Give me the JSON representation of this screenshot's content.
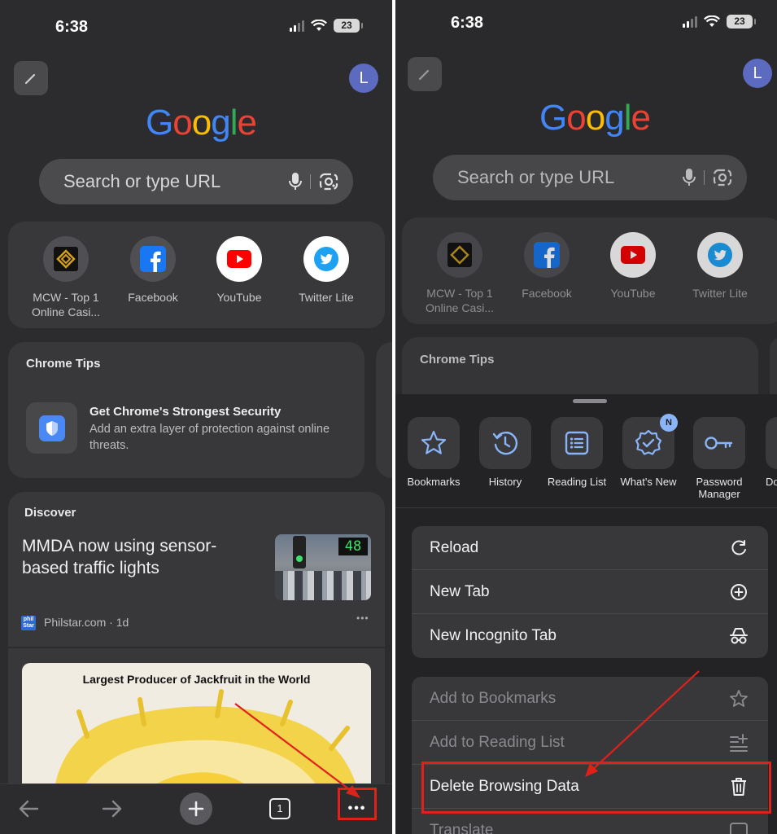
{
  "colors": {
    "highlight": "#e0201b",
    "accent_blue": "#8ab4f8"
  },
  "left": {
    "status": {
      "time": "6:38",
      "battery": "23"
    },
    "avatar_initial": "L",
    "logo": [
      "G",
      "o",
      "o",
      "g",
      "l",
      "e"
    ],
    "search": {
      "placeholder": "Search or type URL",
      "icons": [
        "mic-icon",
        "lens-icon"
      ]
    },
    "shortcuts": [
      {
        "label": "MCW - Top 1 Online Casi...",
        "icon": "mcw-logo"
      },
      {
        "label": "Facebook",
        "icon": "facebook-logo"
      },
      {
        "label": "YouTube",
        "icon": "youtube-logo"
      },
      {
        "label": "Twitter Lite",
        "icon": "twitter-logo"
      }
    ],
    "chrome_tips": {
      "title": "Chrome Tips",
      "tip_title": "Get Chrome's Strongest Security",
      "tip_body": "Add an extra layer of protection against online threats."
    },
    "discover": {
      "title": "Discover",
      "headline": "MMDA now using sensor-based traffic lights",
      "thumb_counter": "48",
      "source": "Philstar.com · 1d",
      "more": "•••",
      "second_image_caption": "Largest Producer of Jackfruit in the World"
    },
    "bottom_bar": {
      "tab_count": "1",
      "more_label": "•••"
    }
  },
  "right": {
    "status": {
      "time": "6:38",
      "battery": "23"
    },
    "avatar_initial": "L",
    "logo": [
      "G",
      "o",
      "o",
      "g",
      "l",
      "e"
    ],
    "search": {
      "placeholder": "Search or type URL"
    },
    "shortcuts": [
      {
        "label": "MCW - Top 1 Online Casi..."
      },
      {
        "label": "Facebook"
      },
      {
        "label": "YouTube"
      },
      {
        "label": "Twitter Lite"
      }
    ],
    "chrome_tips_title": "Chrome Tips",
    "quick_actions": [
      {
        "label": "Bookmarks",
        "icon": "star-icon"
      },
      {
        "label": "History",
        "icon": "history-icon"
      },
      {
        "label": "Reading List",
        "icon": "reading-list-icon"
      },
      {
        "label": "What's New",
        "icon": "whats-new-icon",
        "badge": "N"
      },
      {
        "label": "Password Manager",
        "icon": "key-icon"
      },
      {
        "label": "Do",
        "icon": "download-icon"
      }
    ],
    "menu_group_1": [
      {
        "label": "Reload",
        "icon": "reload-icon"
      },
      {
        "label": "New Tab",
        "icon": "plus-circle-icon"
      },
      {
        "label": "New Incognito Tab",
        "icon": "incognito-icon"
      }
    ],
    "menu_group_2": [
      {
        "label": "Add to Bookmarks",
        "icon": "star-outline-icon",
        "disabled": true
      },
      {
        "label": "Add to Reading List",
        "icon": "add-list-icon",
        "disabled": true
      },
      {
        "label": "Delete Browsing Data",
        "icon": "trash-icon",
        "disabled": false
      },
      {
        "label": "Translate",
        "icon": "translate-icon",
        "disabled": true
      }
    ]
  }
}
